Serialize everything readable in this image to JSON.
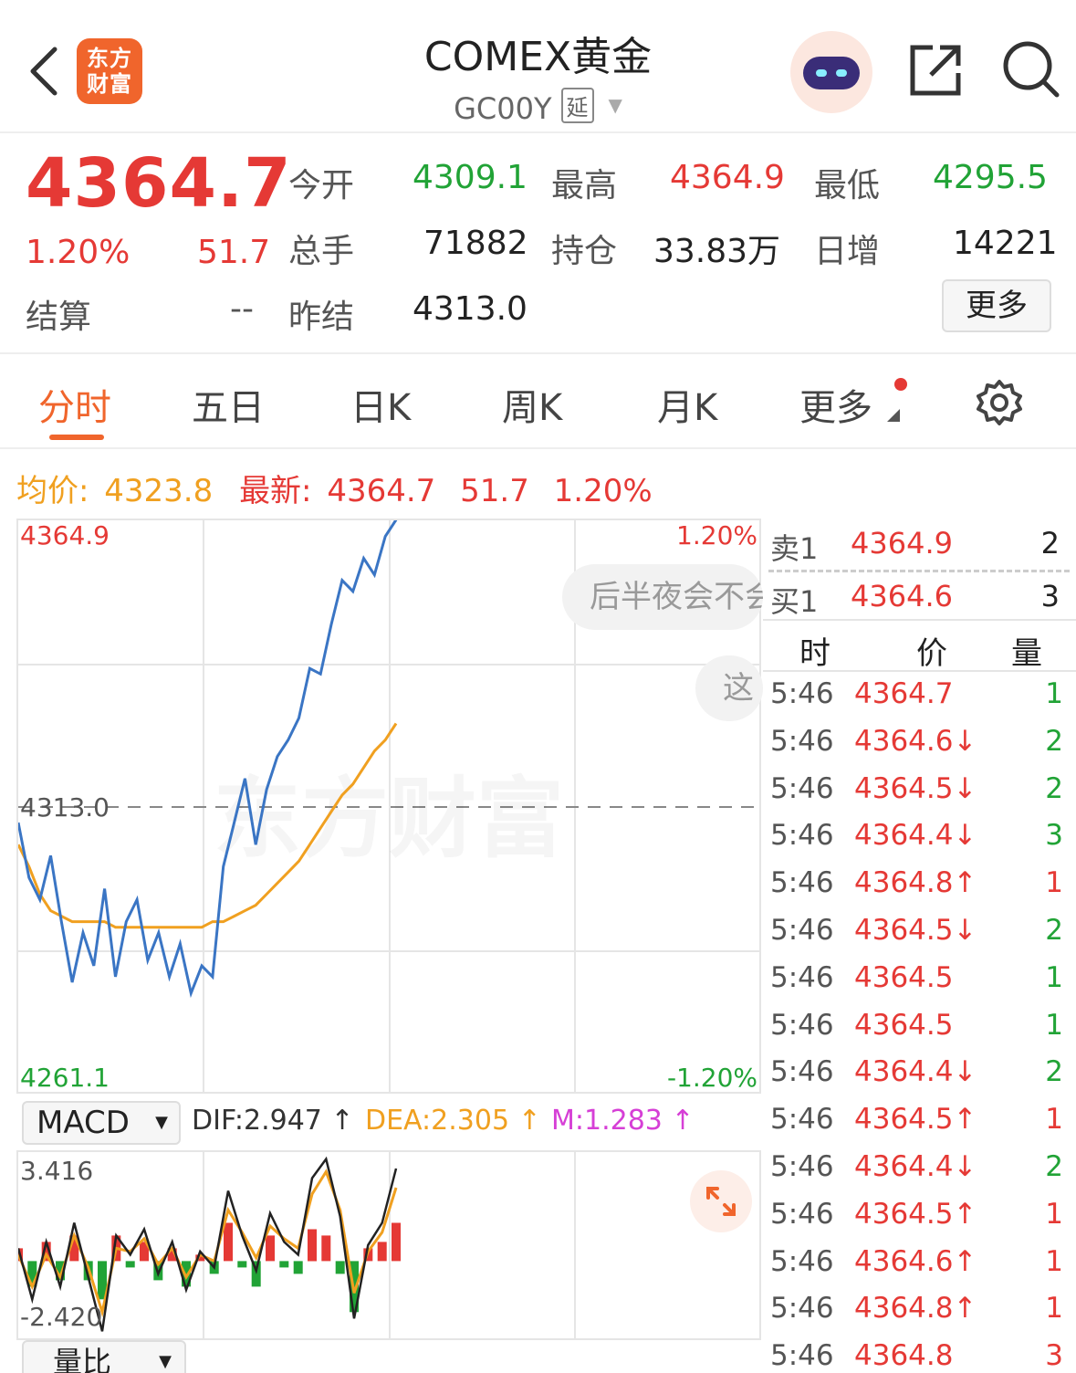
{
  "header": {
    "logo_text_line1": "东方",
    "logo_text_line2": "财富",
    "title": "COMEX黄金",
    "code": "GC00Y",
    "tag": "延"
  },
  "quote": {
    "last": "4364.7",
    "change_pct": "1.20%",
    "change": "51.7",
    "settle_label": "结算",
    "settle_value": "--",
    "open_label": "今开",
    "open_value": "4309.1",
    "high_label": "最高",
    "high_value": "4364.9",
    "low_label": "最低",
    "low_value": "4295.5",
    "volume_label": "总手",
    "volume_value": "71882",
    "oi_label": "持仓",
    "oi_value": "33.83万",
    "daily_inc_label": "日增",
    "daily_inc_value": "14221",
    "prev_settle_label": "昨结",
    "prev_settle_value": "4313.0",
    "more_label": "更多"
  },
  "tabs": [
    "分时",
    "五日",
    "日K",
    "周K",
    "月K",
    "更多"
  ],
  "infoline": {
    "avg_label": "均价:",
    "avg_value": "4323.8",
    "latest_label": "最新:",
    "latest_value": "4364.7",
    "latest_change": "51.7",
    "latest_pct": "1.20%"
  },
  "chart_data": {
    "type": "line",
    "ylim": [
      4261.1,
      4364.9
    ],
    "reference": "4313.0",
    "top_label": "4364.9",
    "bottom_label": "4261.1",
    "top_pct": "1.20%",
    "bottom_pct": "-1.20%",
    "watermark": "东方财富",
    "series": [
      {
        "color": "#3a75c4",
        "values": [
          4310,
          4300,
          4296,
          4304,
          4292,
          4281,
          4290,
          4284,
          4298,
          4282,
          4292,
          4296,
          4285,
          4290,
          4282,
          4288,
          4279,
          4284,
          4282,
          4302,
          4310,
          4318,
          4306,
          4316,
          4322,
          4325,
          4329,
          4338,
          4337,
          4346,
          4354,
          4352,
          4358,
          4355,
          4362,
          4365
        ]
      },
      {
        "color": "#f0a020",
        "values": [
          4306,
          4302,
          4297,
          4294,
          4293,
          4292,
          4292,
          4292,
          4292,
          4291,
          4291,
          4291,
          4291,
          4291,
          4291,
          4291,
          4291,
          4291,
          4292,
          4292,
          4293,
          4294,
          4295,
          4297,
          4299,
          4301,
          4303,
          4306,
          4309,
          4312,
          4315,
          4317,
          4320,
          4323,
          4325,
          4328
        ]
      }
    ]
  },
  "macd": {
    "selector": "MACD",
    "dif": "DIF:2.947 ↑",
    "dea": "DEA:2.305 ↑",
    "m": "M:1.283 ↑",
    "top_label": "3.416",
    "bottom_label": "-2.420",
    "ylim": [
      -2.42,
      3.416
    ],
    "dif_values": [
      0.4,
      -1.2,
      0.6,
      -0.8,
      1.2,
      -0.5,
      -2.2,
      0.8,
      0.2,
      1.0,
      -0.4,
      0.6,
      -0.9,
      0.3,
      -0.2,
      2.2,
      0.8,
      -0.3,
      1.5,
      0.6,
      0.2,
      2.6,
      3.2,
      1.4,
      -1.8,
      0.5,
      1.2,
      2.9
    ],
    "dea_values": [
      0.2,
      -0.8,
      0.2,
      -0.5,
      0.8,
      -0.2,
      -1.6,
      0.4,
      0.3,
      0.7,
      -0.1,
      0.4,
      -0.5,
      0.2,
      0.0,
      1.6,
      0.9,
      0.1,
      1.1,
      0.7,
      0.4,
      2.1,
      2.8,
      1.6,
      -1.0,
      0.3,
      0.9,
      2.3
    ],
    "hist_values": [
      0.4,
      -0.8,
      0.6,
      -0.6,
      0.8,
      -0.6,
      -1.2,
      0.8,
      -0.2,
      0.6,
      -0.6,
      0.4,
      -0.8,
      0.2,
      -0.4,
      1.2,
      -0.2,
      -0.8,
      0.8,
      -0.2,
      -0.4,
      1.0,
      0.8,
      -0.4,
      -1.6,
      0.4,
      0.6,
      1.2
    ]
  },
  "volume_selector": "量比",
  "bubbles": {
    "b1": "后半夜会不会",
    "b2": "这"
  },
  "book": {
    "sell1_label": "卖1",
    "sell1_price": "4364.9",
    "sell1_vol": "2",
    "buy1_label": "买1",
    "buy1_price": "4364.6",
    "buy1_vol": "3",
    "head_time": "时",
    "head_price": "价",
    "head_vol": "量",
    "ticks": [
      {
        "t": "5:46",
        "p": "4364.7",
        "v": "1",
        "vc": "green"
      },
      {
        "t": "5:46",
        "p": "4364.6↓",
        "v": "2",
        "vc": "green"
      },
      {
        "t": "5:46",
        "p": "4364.5↓",
        "v": "2",
        "vc": "green"
      },
      {
        "t": "5:46",
        "p": "4364.4↓",
        "v": "3",
        "vc": "green"
      },
      {
        "t": "5:46",
        "p": "4364.8↑",
        "v": "1",
        "vc": "red"
      },
      {
        "t": "5:46",
        "p": "4364.5↓",
        "v": "2",
        "vc": "green"
      },
      {
        "t": "5:46",
        "p": "4364.5",
        "v": "1",
        "vc": "green"
      },
      {
        "t": "5:46",
        "p": "4364.5",
        "v": "1",
        "vc": "green"
      },
      {
        "t": "5:46",
        "p": "4364.4↓",
        "v": "2",
        "vc": "green"
      },
      {
        "t": "5:46",
        "p": "4364.5↑",
        "v": "1",
        "vc": "red"
      },
      {
        "t": "5:46",
        "p": "4364.4↓",
        "v": "2",
        "vc": "green"
      },
      {
        "t": "5:46",
        "p": "4364.5↑",
        "v": "1",
        "vc": "red"
      },
      {
        "t": "5:46",
        "p": "4364.6↑",
        "v": "1",
        "vc": "red"
      },
      {
        "t": "5:46",
        "p": "4364.8↑",
        "v": "1",
        "vc": "red"
      },
      {
        "t": "5:46",
        "p": "4364.8",
        "v": "3",
        "vc": "red"
      }
    ]
  },
  "colors": {
    "up": "#e53935",
    "down": "#21a336",
    "accent": "#f0652c",
    "avg": "#f0a020",
    "price_line": "#3a75c4",
    "macd_m": "#d63fd6"
  }
}
